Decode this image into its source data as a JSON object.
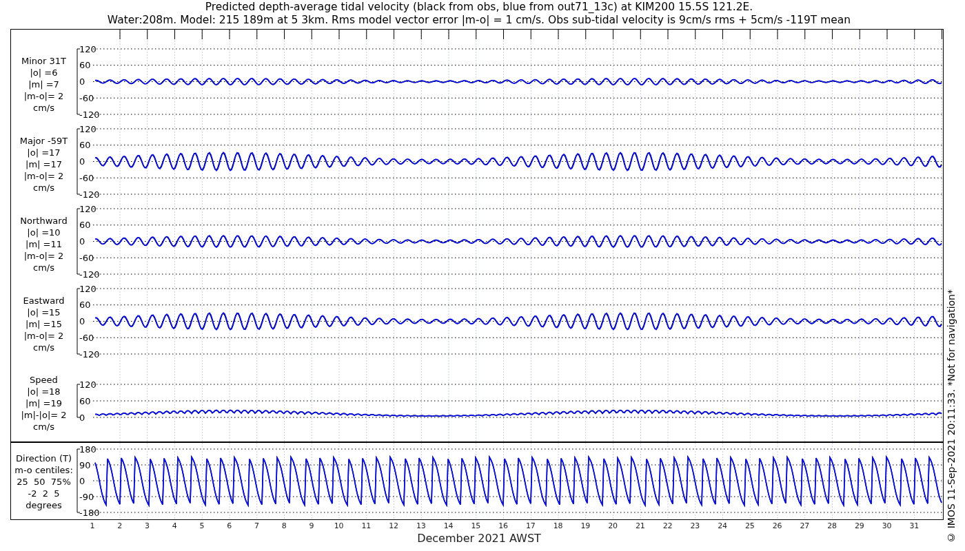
{
  "title": [
    "Predicted depth-average tidal velocity (black from obs, blue from out71_13c) at KIM200 15.5S 121.2E.",
    "Water:208m. Model: 215 189m at 5 3km. Rms model vector error |m-o| = 1 cm/s. Obs sub-tidal velocity is 9cm/s rms + 5cm/s -119T mean"
  ],
  "panels": [
    {
      "kind": "velocity",
      "label": [
        "Minor 31T",
        "|o| =6",
        "|m| =7",
        "|m-o|= 2",
        "cm/s"
      ],
      "yticks": [
        "120",
        "60",
        "0",
        "-60",
        "-120"
      ]
    },
    {
      "kind": "velocity",
      "label": [
        "Major -59T",
        "|o| =17",
        "|m| =17",
        "|m-o|= 2",
        "cm/s"
      ],
      "yticks": [
        "120",
        "60",
        "0",
        "-60",
        "-120"
      ]
    },
    {
      "kind": "velocity",
      "label": [
        "Northward",
        "|o| =10",
        "|m| =11",
        "|m-o|= 2",
        "cm/s"
      ],
      "yticks": [
        "120",
        "60",
        "0",
        "-60",
        "-120"
      ]
    },
    {
      "kind": "velocity",
      "label": [
        "Eastward",
        "|o| =15",
        "|m| =15",
        "|m-o|= 2",
        "cm/s"
      ],
      "yticks": [
        "120",
        "60",
        "0",
        "-60",
        "-120"
      ]
    },
    {
      "kind": "speed",
      "label": [
        "Speed",
        "|o| =18",
        "|m| =19",
        "|m|-|o|= 2",
        "cm/s"
      ],
      "yticks": [
        "120",
        "60",
        "0"
      ]
    },
    {
      "kind": "direction",
      "label": [
        "Direction (T)",
        "m-o centiles:",
        "25  50  75%",
        "-2  2  5",
        "degrees"
      ],
      "yticks": [
        "180",
        "90",
        "0",
        "-90",
        "-180"
      ]
    }
  ],
  "xticks": [
    "1",
    "2",
    "3",
    "4",
    "5",
    "6",
    "7",
    "8",
    "9",
    "10",
    "11",
    "12",
    "13",
    "14",
    "15",
    "16",
    "17",
    "18",
    "19",
    "20",
    "21",
    "22",
    "23",
    "24",
    "25",
    "26",
    "27",
    "28",
    "29",
    "30",
    "31"
  ],
  "xlabel": "December 2021 AWST",
  "credit": "© IMOS 11-Sep-2021 20:11:33. *Not for navigation*"
}
